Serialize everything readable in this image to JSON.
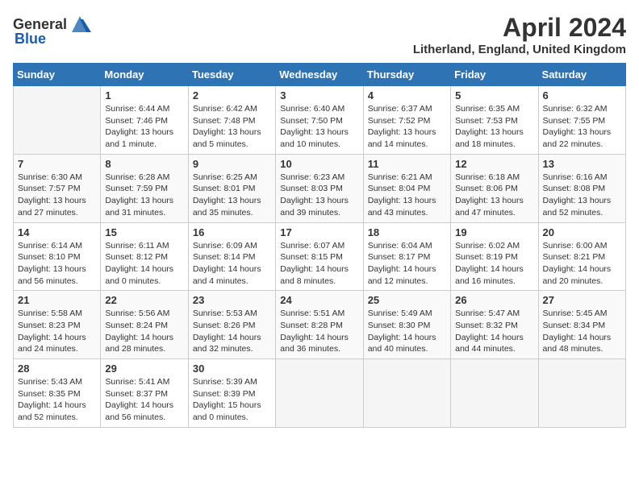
{
  "header": {
    "logo_general": "General",
    "logo_blue": "Blue",
    "month_year": "April 2024",
    "location": "Litherland, England, United Kingdom"
  },
  "days_of_week": [
    "Sunday",
    "Monday",
    "Tuesday",
    "Wednesday",
    "Thursday",
    "Friday",
    "Saturday"
  ],
  "weeks": [
    [
      {
        "num": "",
        "detail": ""
      },
      {
        "num": "1",
        "detail": "Sunrise: 6:44 AM\nSunset: 7:46 PM\nDaylight: 13 hours\nand 1 minute."
      },
      {
        "num": "2",
        "detail": "Sunrise: 6:42 AM\nSunset: 7:48 PM\nDaylight: 13 hours\nand 5 minutes."
      },
      {
        "num": "3",
        "detail": "Sunrise: 6:40 AM\nSunset: 7:50 PM\nDaylight: 13 hours\nand 10 minutes."
      },
      {
        "num": "4",
        "detail": "Sunrise: 6:37 AM\nSunset: 7:52 PM\nDaylight: 13 hours\nand 14 minutes."
      },
      {
        "num": "5",
        "detail": "Sunrise: 6:35 AM\nSunset: 7:53 PM\nDaylight: 13 hours\nand 18 minutes."
      },
      {
        "num": "6",
        "detail": "Sunrise: 6:32 AM\nSunset: 7:55 PM\nDaylight: 13 hours\nand 22 minutes."
      }
    ],
    [
      {
        "num": "7",
        "detail": "Sunrise: 6:30 AM\nSunset: 7:57 PM\nDaylight: 13 hours\nand 27 minutes."
      },
      {
        "num": "8",
        "detail": "Sunrise: 6:28 AM\nSunset: 7:59 PM\nDaylight: 13 hours\nand 31 minutes."
      },
      {
        "num": "9",
        "detail": "Sunrise: 6:25 AM\nSunset: 8:01 PM\nDaylight: 13 hours\nand 35 minutes."
      },
      {
        "num": "10",
        "detail": "Sunrise: 6:23 AM\nSunset: 8:03 PM\nDaylight: 13 hours\nand 39 minutes."
      },
      {
        "num": "11",
        "detail": "Sunrise: 6:21 AM\nSunset: 8:04 PM\nDaylight: 13 hours\nand 43 minutes."
      },
      {
        "num": "12",
        "detail": "Sunrise: 6:18 AM\nSunset: 8:06 PM\nDaylight: 13 hours\nand 47 minutes."
      },
      {
        "num": "13",
        "detail": "Sunrise: 6:16 AM\nSunset: 8:08 PM\nDaylight: 13 hours\nand 52 minutes."
      }
    ],
    [
      {
        "num": "14",
        "detail": "Sunrise: 6:14 AM\nSunset: 8:10 PM\nDaylight: 13 hours\nand 56 minutes."
      },
      {
        "num": "15",
        "detail": "Sunrise: 6:11 AM\nSunset: 8:12 PM\nDaylight: 14 hours\nand 0 minutes."
      },
      {
        "num": "16",
        "detail": "Sunrise: 6:09 AM\nSunset: 8:14 PM\nDaylight: 14 hours\nand 4 minutes."
      },
      {
        "num": "17",
        "detail": "Sunrise: 6:07 AM\nSunset: 8:15 PM\nDaylight: 14 hours\nand 8 minutes."
      },
      {
        "num": "18",
        "detail": "Sunrise: 6:04 AM\nSunset: 8:17 PM\nDaylight: 14 hours\nand 12 minutes."
      },
      {
        "num": "19",
        "detail": "Sunrise: 6:02 AM\nSunset: 8:19 PM\nDaylight: 14 hours\nand 16 minutes."
      },
      {
        "num": "20",
        "detail": "Sunrise: 6:00 AM\nSunset: 8:21 PM\nDaylight: 14 hours\nand 20 minutes."
      }
    ],
    [
      {
        "num": "21",
        "detail": "Sunrise: 5:58 AM\nSunset: 8:23 PM\nDaylight: 14 hours\nand 24 minutes."
      },
      {
        "num": "22",
        "detail": "Sunrise: 5:56 AM\nSunset: 8:24 PM\nDaylight: 14 hours\nand 28 minutes."
      },
      {
        "num": "23",
        "detail": "Sunrise: 5:53 AM\nSunset: 8:26 PM\nDaylight: 14 hours\nand 32 minutes."
      },
      {
        "num": "24",
        "detail": "Sunrise: 5:51 AM\nSunset: 8:28 PM\nDaylight: 14 hours\nand 36 minutes."
      },
      {
        "num": "25",
        "detail": "Sunrise: 5:49 AM\nSunset: 8:30 PM\nDaylight: 14 hours\nand 40 minutes."
      },
      {
        "num": "26",
        "detail": "Sunrise: 5:47 AM\nSunset: 8:32 PM\nDaylight: 14 hours\nand 44 minutes."
      },
      {
        "num": "27",
        "detail": "Sunrise: 5:45 AM\nSunset: 8:34 PM\nDaylight: 14 hours\nand 48 minutes."
      }
    ],
    [
      {
        "num": "28",
        "detail": "Sunrise: 5:43 AM\nSunset: 8:35 PM\nDaylight: 14 hours\nand 52 minutes."
      },
      {
        "num": "29",
        "detail": "Sunrise: 5:41 AM\nSunset: 8:37 PM\nDaylight: 14 hours\nand 56 minutes."
      },
      {
        "num": "30",
        "detail": "Sunrise: 5:39 AM\nSunset: 8:39 PM\nDaylight: 15 hours\nand 0 minutes."
      },
      {
        "num": "",
        "detail": ""
      },
      {
        "num": "",
        "detail": ""
      },
      {
        "num": "",
        "detail": ""
      },
      {
        "num": "",
        "detail": ""
      }
    ]
  ]
}
